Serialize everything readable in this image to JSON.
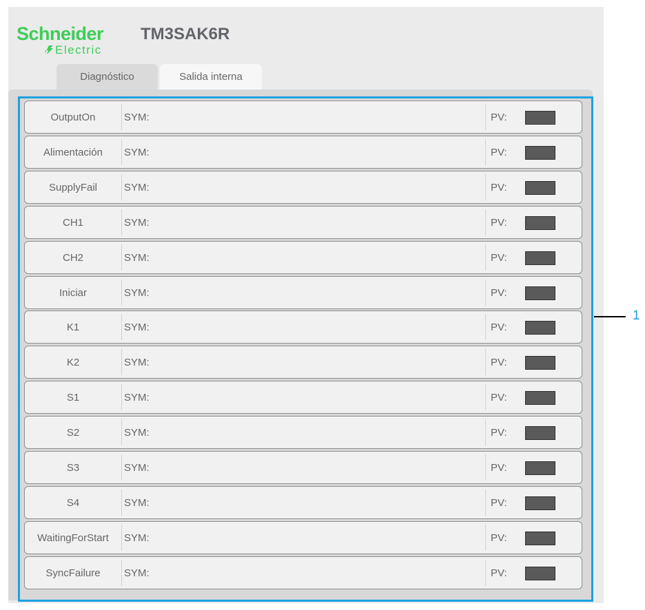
{
  "brand": {
    "name": "Schneider",
    "sub": "Electric",
    "color": "#3dcd58"
  },
  "device_title": "TM3SAK6R",
  "tabs": [
    {
      "label": "Diagnóstico",
      "active": true
    },
    {
      "label": "Salida interna",
      "active": false
    }
  ],
  "rows": [
    {
      "name": "OutputOn",
      "sym": "SYM:",
      "pv": "PV:"
    },
    {
      "name": "Alimentación",
      "sym": "SYM:",
      "pv": "PV:"
    },
    {
      "name": "SupplyFail",
      "sym": "SYM:",
      "pv": "PV:"
    },
    {
      "name": "CH1",
      "sym": "SYM:",
      "pv": "PV:"
    },
    {
      "name": "CH2",
      "sym": "SYM:",
      "pv": "PV:"
    },
    {
      "name": "Iniciar",
      "sym": "SYM:",
      "pv": "PV:"
    },
    {
      "name": "K1",
      "sym": "SYM:",
      "pv": "PV:"
    },
    {
      "name": "K2",
      "sym": "SYM:",
      "pv": "PV:"
    },
    {
      "name": "S1",
      "sym": "SYM:",
      "pv": "PV:"
    },
    {
      "name": "S2",
      "sym": "SYM:",
      "pv": "PV:"
    },
    {
      "name": "S3",
      "sym": "SYM:",
      "pv": "PV:"
    },
    {
      "name": "S4",
      "sym": "SYM:",
      "pv": "PV:"
    },
    {
      "name": "WaitingForStart",
      "sym": "SYM:",
      "pv": "PV:"
    },
    {
      "name": "SyncFailure",
      "sym": "SYM:",
      "pv": "PV:"
    }
  ],
  "callout": {
    "number": "1",
    "color": "#1da1e0"
  }
}
